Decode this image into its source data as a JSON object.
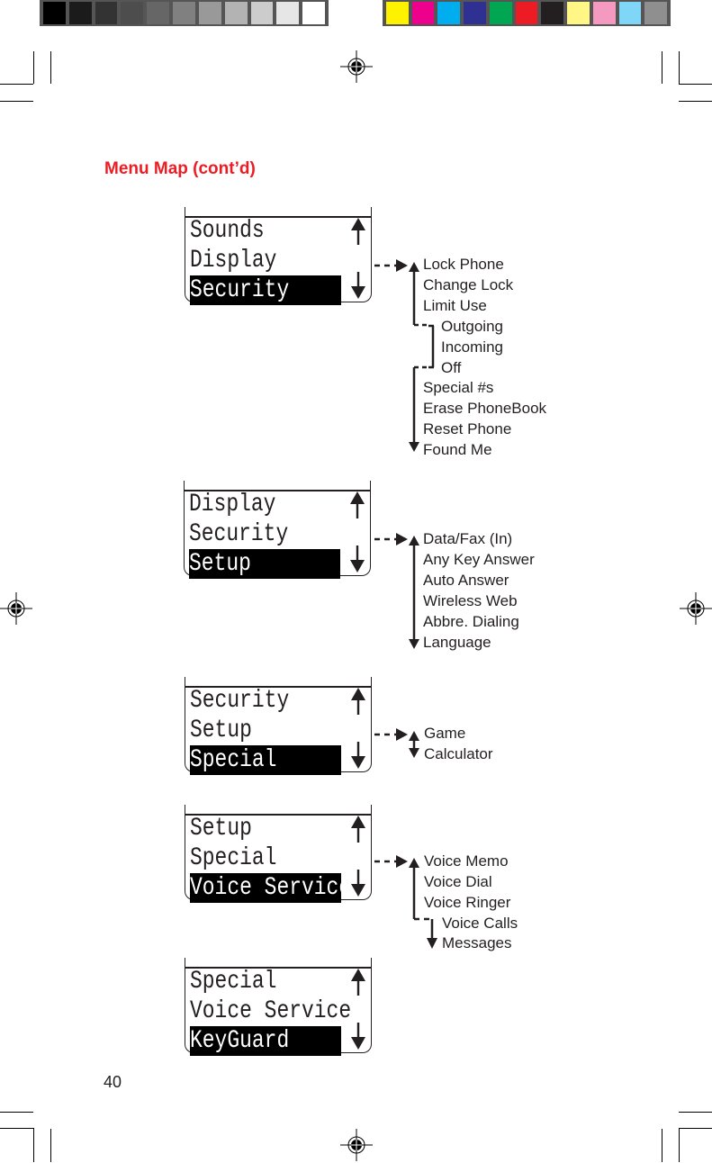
{
  "color_bars": {
    "grayscale": [
      "#000000",
      "#1b1b1b",
      "#333333",
      "#4d4d4d",
      "#666666",
      "#808080",
      "#999999",
      "#b3b3b3",
      "#cccccc",
      "#e6e6e6",
      "#ffffff"
    ],
    "process": [
      "#fff200",
      "#ec008c",
      "#00aeef",
      "#2e3192",
      "#00a651",
      "#ed1c24",
      "#231f20",
      "#fff685",
      "#f49ac1",
      "#7fd6f7",
      "#8f8f8f"
    ]
  },
  "page": {
    "title": "Menu Map (cont’d)",
    "page_number": "40",
    "title_color": "#ed1c24"
  },
  "screens": [
    {
      "rows": [
        "Sounds",
        "Display"
      ],
      "selected": "Security",
      "submenu": {
        "items": [
          "Lock Phone",
          "Change Lock",
          "Limit Use"
        ],
        "nested": [
          "Outgoing",
          "Incoming",
          "Off"
        ],
        "after": [
          "Special #s",
          "Erase PhoneBook",
          "Reset Phone",
          "Found Me"
        ]
      }
    },
    {
      "rows": [
        "Display",
        "Security"
      ],
      "selected": "Setup",
      "submenu": {
        "items": [
          "Data/Fax (In)",
          "Any Key Answer",
          "Auto Answer",
          "Wireless Web",
          "Abbre. Dialing",
          "Language"
        ]
      }
    },
    {
      "rows": [
        "Security",
        "Setup"
      ],
      "selected": "Special",
      "submenu": {
        "items": [
          "Game",
          "Calculator"
        ]
      }
    },
    {
      "rows": [
        "Setup",
        "Special"
      ],
      "selected": "Voice Service",
      "submenu": {
        "items": [
          "Voice Memo",
          "Voice Dial",
          "Voice Ringer"
        ],
        "nested": [
          "Voice Calls",
          "Messages"
        ]
      }
    },
    {
      "rows": [
        "Special",
        "Voice Service"
      ],
      "selected": "KeyGuard"
    }
  ],
  "icons": {
    "scroll_up": "up-arrow-icon",
    "scroll_down": "down-arrow-icon",
    "registration_mark": "registration-mark-icon",
    "link_arrow": "dashed-arrow-icon"
  }
}
